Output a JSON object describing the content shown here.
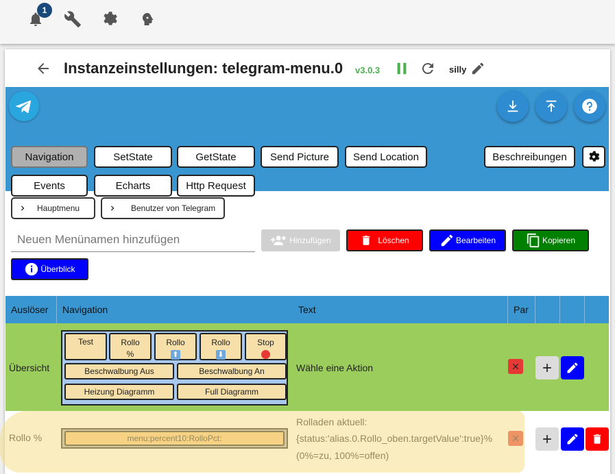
{
  "topbar": {
    "notification_count": "1",
    "icons": [
      "bell-icon",
      "wrench-icon",
      "gear-icon",
      "head-icon"
    ]
  },
  "header": {
    "title": "Instanzeinstellungen: telegram-menu.0",
    "version": "v3.0.3",
    "log_level": "silly"
  },
  "colors": {
    "blue": "#3a96d1",
    "green_row": "#9acd5b",
    "red": "#ff0000",
    "blue_btn": "#0000ff",
    "copy_green": "#008000"
  },
  "tabs": [
    "Navigation",
    "SetState",
    "GetState",
    "Send Picture",
    "Send Location",
    "Events",
    "Echarts",
    "Http Request"
  ],
  "beschreibungen": "Beschreibungen",
  "nav_buttons": [
    "Hauptmenu",
    "Benutzer von Telegram"
  ],
  "menu_input_placeholder": "Neuen Menünamen hinzufügen",
  "actions": {
    "add": "Hinzufügen",
    "delete": "Löschen",
    "edit": "Bearbeiten",
    "copy": "Kopieren",
    "overview": "Überblick"
  },
  "table": {
    "headers": [
      "Auslöser",
      "Navigation",
      "Text",
      "Par"
    ],
    "rows": [
      {
        "trigger": "Übersicht",
        "keyboard": [
          [
            "Test",
            "Rollo %",
            "Rollo ⬆️",
            "Rollo ⬇️",
            "Stop 🔴"
          ],
          [
            "Beschwalbung Aus",
            "Beschwalbung An"
          ],
          [
            "Heizung Diagramm",
            "Full Diagramm"
          ]
        ],
        "key_labels": {
          "test": "Test",
          "rollo_pct_1": "Rollo",
          "rollo_pct_2": "%",
          "rollo_up_1": "Rollo",
          "rollo_up_2": "⬆",
          "rollo_down_1": "Rollo",
          "rollo_down_2": "⬇",
          "stop_1": "Stop",
          "beschw_aus": "Beschwalbung Aus",
          "beschw_an": "Beschwalbung An",
          "heizung": "Heizung Diagramm",
          "full": "Full Diagramm"
        },
        "text": "Wähle eine Aktion"
      },
      {
        "trigger": "Rollo %",
        "keyboard_value": "menu:percent10:RolloPct:",
        "text_line1": "Rolladen aktuell:",
        "text_line2": "{status:'alias.0.Rollo_oben.targetValue':true}%",
        "text_line3": "(0%=zu, 100%=offen)"
      }
    ]
  }
}
